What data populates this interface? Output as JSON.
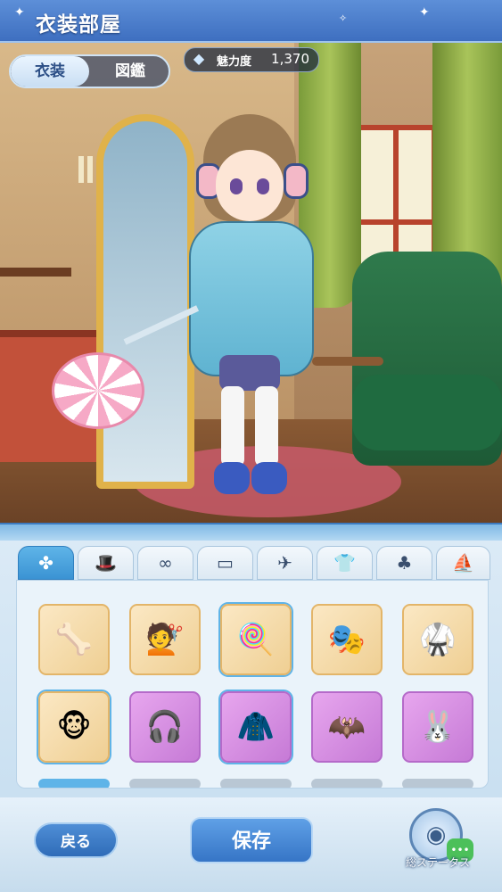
{
  "header": {
    "title": "衣装部屋"
  },
  "mode_tabs": [
    {
      "label": "衣装",
      "active": true
    },
    {
      "label": "図鑑",
      "active": false
    }
  ],
  "charm": {
    "label": "魅力度",
    "value": "1,370",
    "icon": "diamond-icon"
  },
  "category_tabs": [
    {
      "icon": "clover-icon",
      "active": true
    },
    {
      "icon": "hat-icon",
      "active": false
    },
    {
      "icon": "glasses-icon",
      "active": false
    },
    {
      "icon": "face-accessory-icon",
      "active": false
    },
    {
      "icon": "wing-icon",
      "active": false
    },
    {
      "icon": "shirt-icon",
      "active": false
    },
    {
      "icon": "pet-icon",
      "active": false
    },
    {
      "icon": "ship-icon",
      "active": false
    }
  ],
  "items": [
    {
      "icon": "horned-helm",
      "glyph": "🦴",
      "rarity": "gold",
      "selected": false
    },
    {
      "icon": "brown-hair",
      "glyph": "💇",
      "rarity": "gold",
      "selected": false
    },
    {
      "icon": "lollipop",
      "glyph": "🍭",
      "rarity": "gold",
      "selected": true
    },
    {
      "icon": "mask",
      "glyph": "🎭",
      "rarity": "gold",
      "selected": false
    },
    {
      "icon": "red-armor",
      "glyph": "🥋",
      "rarity": "gold",
      "selected": false
    },
    {
      "icon": "monkey-plush",
      "glyph": "🐵",
      "rarity": "gold",
      "selected": true
    },
    {
      "icon": "pink-headphones",
      "glyph": "🎧",
      "rarity": "purple",
      "selected": false
    },
    {
      "icon": "blue-coat",
      "glyph": "🧥",
      "rarity": "purple",
      "selected": true
    },
    {
      "icon": "bat-wings",
      "glyph": "🦇",
      "rarity": "purple",
      "selected": false
    },
    {
      "icon": "bunny-plush",
      "glyph": "🐰",
      "rarity": "purple",
      "selected": false
    }
  ],
  "bottom": {
    "back_label": "戻る",
    "save_label": "保存",
    "stats_label": "総ステータス"
  },
  "colors": {
    "accent": "#3b93d3",
    "gold": "#efcf93",
    "purple": "#c67ad6"
  }
}
